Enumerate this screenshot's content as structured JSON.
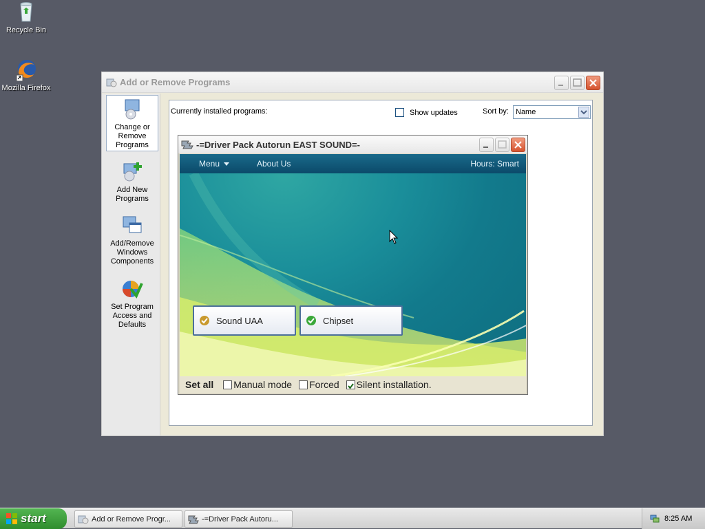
{
  "desktop": {
    "icons": [
      {
        "label": "Recycle Bin",
        "icon": "recycle-bin-icon"
      },
      {
        "label": "Mozilla Firefox",
        "icon": "firefox-icon"
      }
    ]
  },
  "arp_window": {
    "title": "Add or Remove Programs",
    "sidebar": [
      {
        "label": "Change or Remove Programs",
        "icon": "change-remove-programs-icon",
        "active": true
      },
      {
        "label": "Add New Programs",
        "icon": "add-new-programs-icon",
        "active": false
      },
      {
        "label": "Add/Remove Windows Components",
        "icon": "windows-components-icon",
        "active": false
      },
      {
        "label": "Set Program Access and Defaults",
        "icon": "program-access-defaults-icon",
        "active": false
      }
    ],
    "currently_installed": "Currently installed programs:",
    "show_updates": "Show updates",
    "show_updates_checked": false,
    "sort_by_label": "Sort by:",
    "sort_by_value": "Name"
  },
  "driver_window": {
    "title": "-=Driver Pack Autorun EAST SOUND=-",
    "menu": "Menu",
    "about": "About Us",
    "hours": "Hours: Smart",
    "buttons": [
      {
        "label": "Sound UAA",
        "status": "warning",
        "color": "#c99a2e"
      },
      {
        "label": "Chipset",
        "status": "ok",
        "color": "#3aa83a"
      }
    ],
    "footer": {
      "set_all": "Set all",
      "manual_mode": "Manual mode",
      "manual_mode_checked": false,
      "forced": "Forced",
      "forced_checked": false,
      "silent": "Silent installation.",
      "silent_checked": true
    }
  },
  "taskbar": {
    "start": "start",
    "tasks": [
      {
        "label": "Add or Remove Progr...",
        "icon": "add-remove-programs-icon"
      },
      {
        "label": "-=Driver Pack Autoru...",
        "icon": "driver-pack-icon"
      }
    ],
    "clock": "8:25 AM",
    "tray_icon": "network-tray-icon"
  }
}
